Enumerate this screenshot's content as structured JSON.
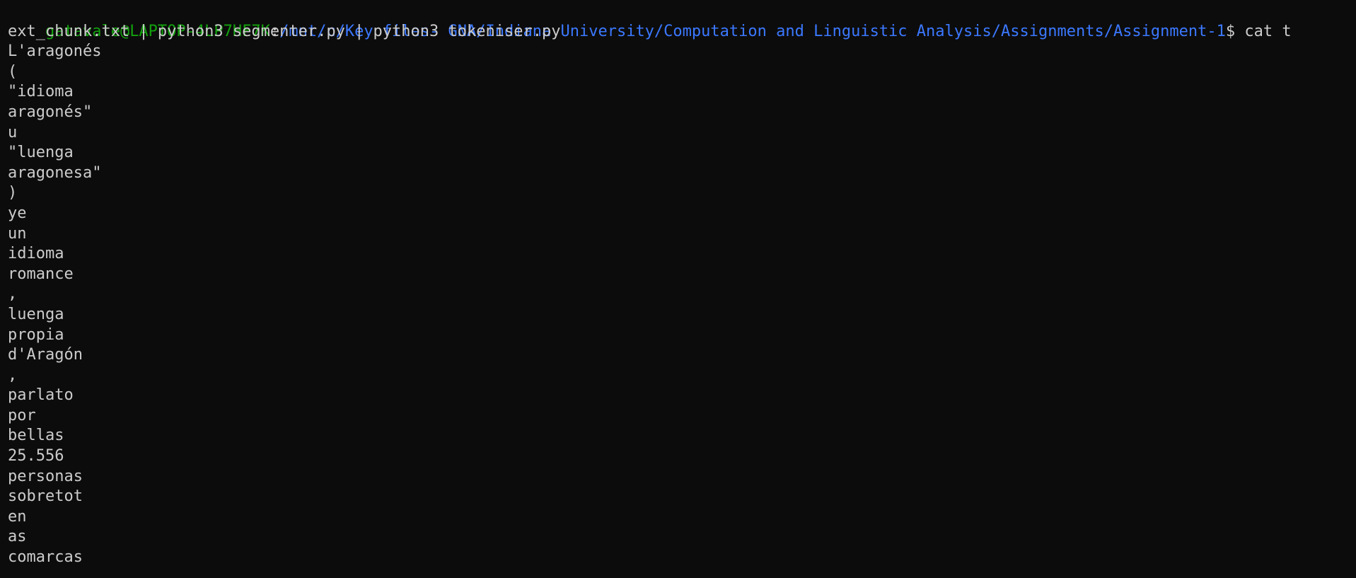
{
  "terminal": {
    "prompt": {
      "user_host": "gatavale@LAPTOP-4LP7HF7K",
      "separator": ":",
      "cwd": "/mnt/c/Key files- GNA/Indiana University/Computation and Linguistic Analysis/Assignments/Assignment-1",
      "symbol": "$ ",
      "command_part1": "cat t"
    },
    "command_continuation": "ext_chunk.txt | python3 segmenter.py | python3 tokeniser.py",
    "output_lines": [
      "L'aragonés",
      "(",
      "\"idioma",
      "aragonés\"",
      "u",
      "\"luenga",
      "aragonesa\"",
      ")",
      "ye",
      "un",
      "idioma",
      "romance",
      ",",
      "luenga",
      "propia",
      "d'Aragón",
      ",",
      "parlato",
      "por",
      "bellas",
      "25.556",
      "personas",
      "sobretot",
      "en",
      "as",
      "comarcas"
    ],
    "colors": {
      "background": "#0c0c0c",
      "foreground": "#cccccc",
      "user_host": "#13a10e",
      "path": "#3b78ff"
    }
  }
}
